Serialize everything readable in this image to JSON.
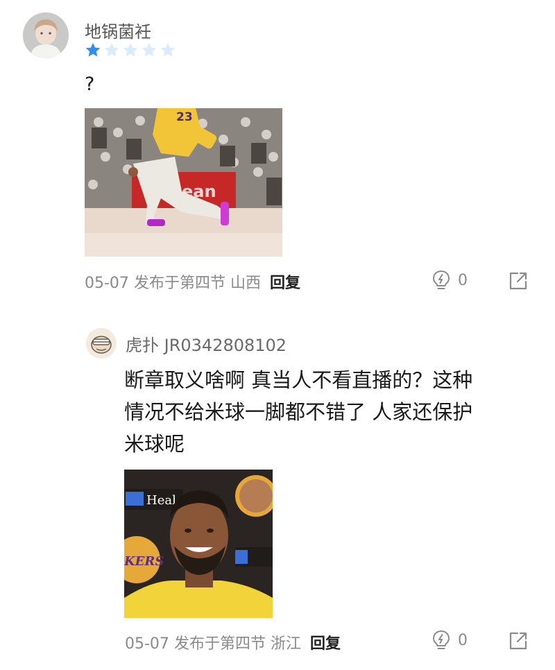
{
  "comment": {
    "username": "地锅菌衽",
    "rating": 1,
    "rating_max": 5,
    "text": "?",
    "date": "05-07",
    "posted_in": "发布于第四节",
    "location": "山西",
    "reply_label": "回复",
    "like_count": "0",
    "photo_jersey_number": "23"
  },
  "reply": {
    "username": "虎扑 JR0342808102",
    "text_lines": [
      "断章取义啥啊 真当人不看直播的？这种",
      "情况不给米球一脚都不错了 人家还保护",
      "米球呢"
    ],
    "date": "05-07",
    "posted_in": "发布于第四节",
    "location": "浙江",
    "reply_label": "回复",
    "like_count": "0",
    "photo_sign_text": "Heal",
    "photo_logo_text": "KERS"
  },
  "colors": {
    "star_active": "#2f8ef0",
    "star_inactive": "#d9ecfd",
    "meta_text": "#8a8a8a"
  },
  "icons": [
    "star-icon",
    "lightbulb-icon",
    "share-icon"
  ]
}
